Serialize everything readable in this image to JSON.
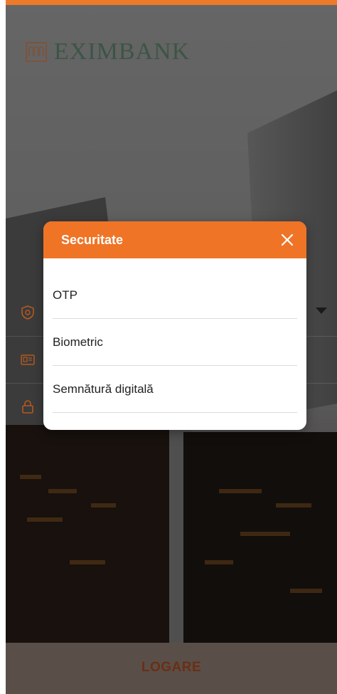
{
  "brand": {
    "name": "EXIMBANK"
  },
  "modal": {
    "title": "Securitate",
    "options": [
      {
        "label": "OTP"
      },
      {
        "label": "Biometric"
      },
      {
        "label": "Semnătură digitală"
      }
    ]
  },
  "login": {
    "button_label": "LOGARE"
  },
  "colors": {
    "accent": "#ef7426",
    "brand_green": "#1b4a2c",
    "overlay": "rgba(0,0,0,0.58)"
  },
  "icons": [
    "brand-logo",
    "shield-icon",
    "id-card-icon",
    "lock-icon",
    "chevron-down-icon",
    "close-icon"
  ]
}
